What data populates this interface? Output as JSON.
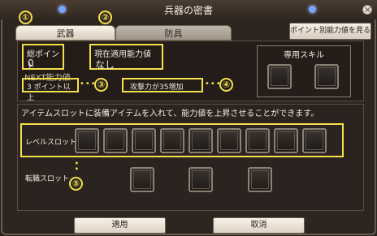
{
  "window": {
    "title": "兵器の密書",
    "tabs": [
      "武器",
      "防具"
    ],
    "top_right_button": "ポイント別能力値を見る"
  },
  "stats": {
    "total_points_label": "総ポイント",
    "total_points_value": "0",
    "current_ability_label": "現在適用能力値",
    "current_ability_value": "なし",
    "next_ability_label": "NEXT能力値",
    "points_requirement": "3 ポイント以上",
    "bonus_text": "攻撃力が35増加",
    "special_skill_label": "専用スキル"
  },
  "item_slots": {
    "instruction": "アイテムスロットに装備アイテムを入れて、能力値を上昇させることができます。",
    "level_slot_label": "レベルスロット",
    "job_change_slot_label": "転職スロット"
  },
  "buttons": {
    "apply": "適用",
    "cancel": "取消"
  },
  "markers": [
    "①",
    "②",
    "③",
    "④",
    "⑤"
  ]
}
